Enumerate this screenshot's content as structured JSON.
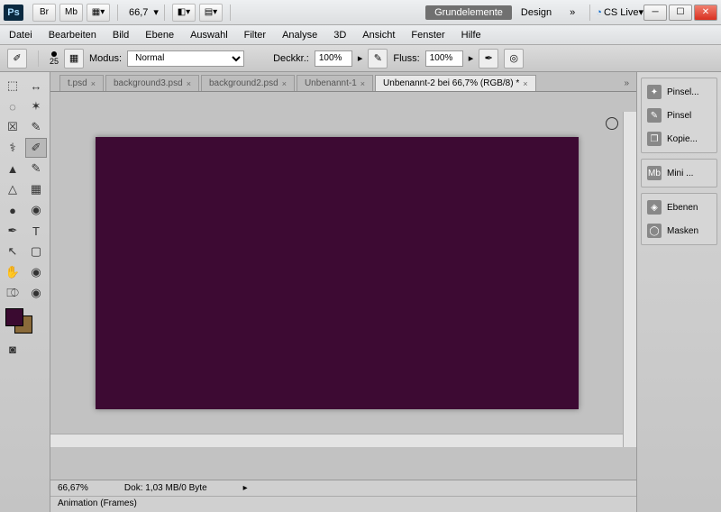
{
  "titlebar": {
    "logo": "Ps",
    "br_label": "Br",
    "mb_label": "Mb",
    "zoom_display": "66,7",
    "workspace_active": "Grundelemente",
    "workspace_other": "Design",
    "cslive": "CS Live"
  },
  "menubar": [
    "Datei",
    "Bearbeiten",
    "Bild",
    "Ebene",
    "Auswahl",
    "Filter",
    "Analyse",
    "3D",
    "Ansicht",
    "Fenster",
    "Hilfe"
  ],
  "options": {
    "brush_size": "25",
    "modus_label": "Modus:",
    "modus_value": "Normal",
    "deckkr_label": "Deckkr.:",
    "deckkr_value": "100%",
    "fluss_label": "Fluss:",
    "fluss_value": "100%"
  },
  "doc_tabs": [
    {
      "label": "t.psd",
      "active": false
    },
    {
      "label": "background3.psd",
      "active": false
    },
    {
      "label": "background2.psd",
      "active": false
    },
    {
      "label": "Unbenannt-1",
      "active": false
    },
    {
      "label": "Unbenannt-2 bei 66,7% (RGB/8) *",
      "active": true
    }
  ],
  "canvas": {
    "fill": "#3d0a33"
  },
  "status": {
    "zoom": "66,67%",
    "doc": "Dok: 1,03 MB/0 Byte"
  },
  "anim_panel": "Animation (Frames)",
  "dock": {
    "group1": [
      {
        "label": "Pinsel...",
        "ico": "✦"
      },
      {
        "label": "Pinsel",
        "ico": "✎"
      },
      {
        "label": "Kopie...",
        "ico": "❐"
      }
    ],
    "group2": [
      {
        "label": "Mini ...",
        "ico": "Mb"
      }
    ],
    "group3": [
      {
        "label": "Ebenen",
        "ico": "◈"
      },
      {
        "label": "Masken",
        "ico": "◯"
      }
    ]
  },
  "swatches": {
    "fg": "#3a0a30",
    "bg": "#8a6a3a"
  },
  "tools": [
    "▭",
    "↔",
    "�◌",
    "✶",
    "☐",
    "✎",
    "⚕",
    "✐",
    "▲",
    "⊟",
    "△",
    "◎",
    "✒",
    "T",
    "↖",
    "▢",
    "✋",
    "◉",
    "⎄",
    "◉"
  ]
}
